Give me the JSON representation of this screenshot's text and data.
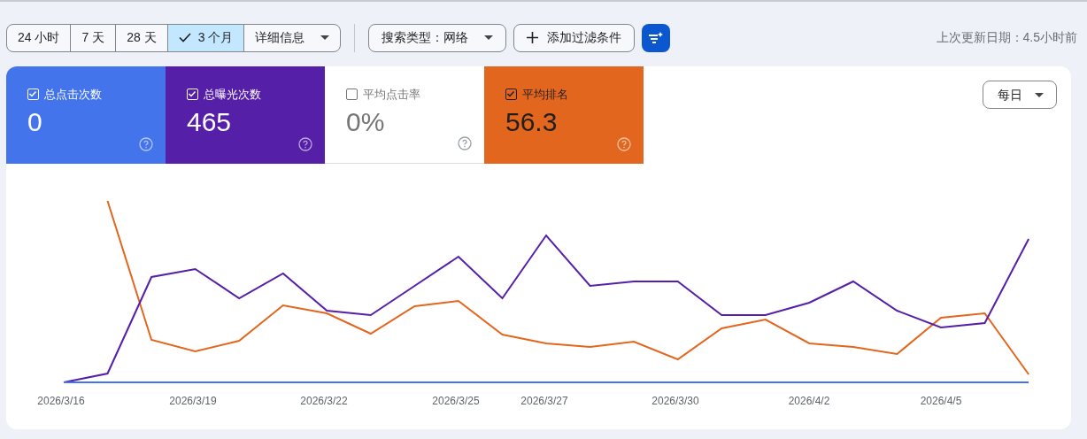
{
  "toolbar": {
    "ranges": [
      {
        "label": "24 小时",
        "selected": false
      },
      {
        "label": "7 天",
        "selected": false
      },
      {
        "label": "28 天",
        "selected": false
      },
      {
        "label": "3 个月",
        "selected": true
      }
    ],
    "details": "详细信息",
    "search_type": "搜索类型：网络",
    "add_filter": "添加过滤条件",
    "last_updated": "上次更新日期：4.5小时前"
  },
  "metrics": [
    {
      "label": "总点击次数",
      "value": "0",
      "checked": true,
      "color": "#4374ec"
    },
    {
      "label": "总曝光次数",
      "value": "465",
      "checked": true,
      "color": "#551fa8"
    },
    {
      "label": "平均点击率",
      "value": "0%",
      "checked": false
    },
    {
      "label": "平均排名",
      "value": "56.3",
      "checked": true,
      "color": "#e3661e"
    }
  ],
  "granularity": "每日",
  "chart": {
    "x_labels": [
      "2026/3/16",
      "2026/3/19",
      "2026/3/22",
      "2026/3/25",
      "2026/3/27",
      "2026/3/30",
      "2026/4/2",
      "2026/4/5"
    ]
  }
}
